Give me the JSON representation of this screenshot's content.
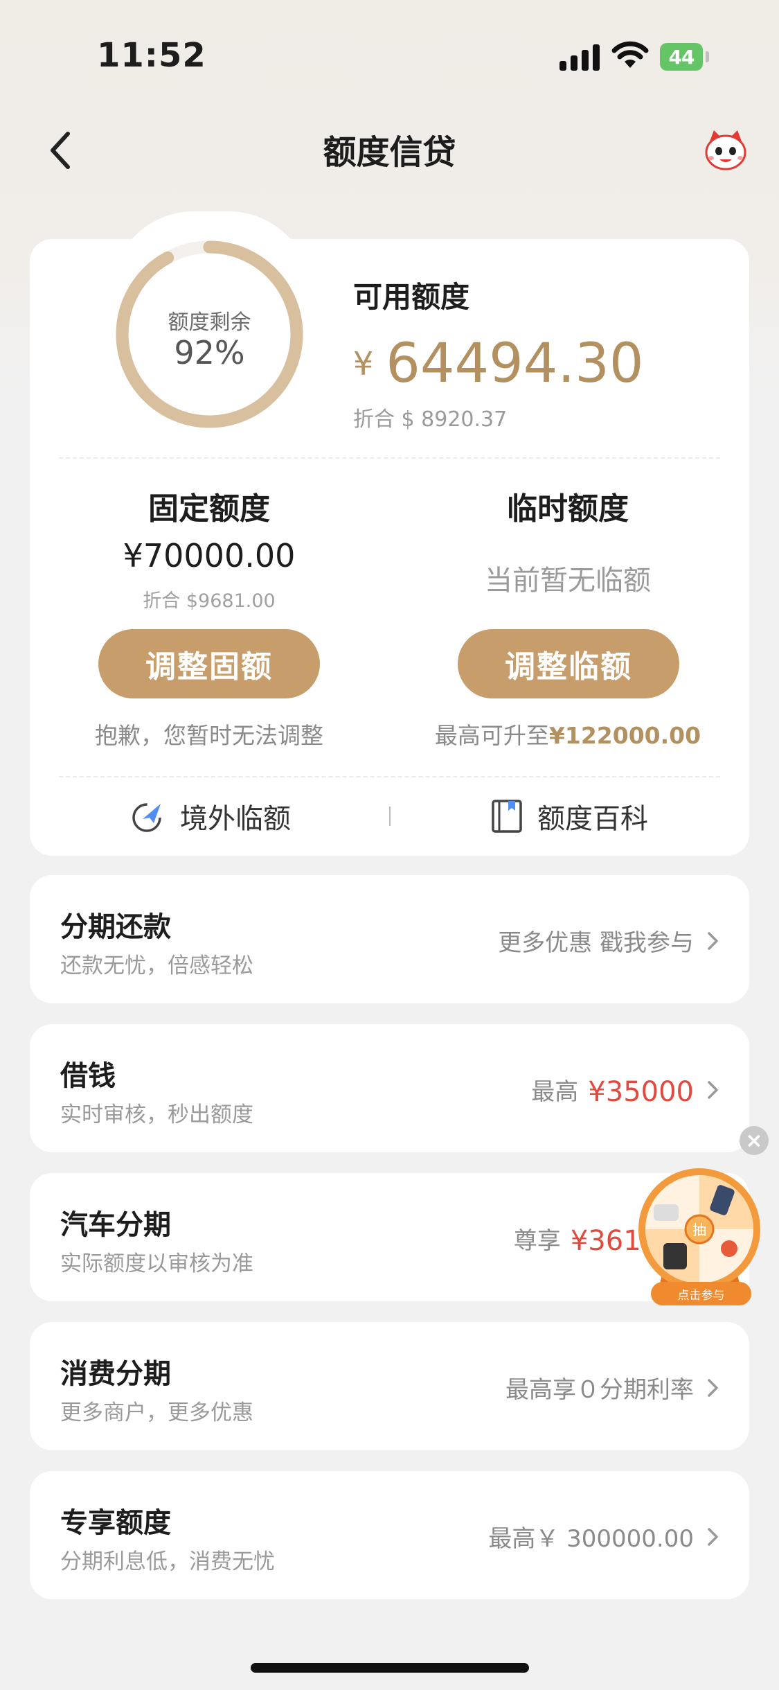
{
  "status_bar": {
    "time": "11:52",
    "battery": "44"
  },
  "nav": {
    "title": "额度信贷"
  },
  "summary": {
    "ring_label": "额度剩余",
    "ring_value": "92%",
    "ring_fraction": 0.92,
    "available_label": "可用额度",
    "available_currency": "¥",
    "available_amount": "64494.30",
    "available_usd": "折合 $ 8920.37"
  },
  "fixed": {
    "title": "固定额度",
    "amount": "¥70000.00",
    "usd": "折合 $9681.00",
    "button": "调整固额",
    "note": "抱歉，您暂时无法调整"
  },
  "temp": {
    "title": "临时额度",
    "status": "当前暂无临额",
    "button": "调整临额",
    "note_prefix": "最高可升至",
    "note_amount": "¥122000.00"
  },
  "links": {
    "overseas": "境外临额",
    "wiki": "额度百科"
  },
  "rows": [
    {
      "title": "分期还款",
      "sub": "还款无忧，倍感轻松",
      "right": "更多优惠 戳我参与",
      "highlight": ""
    },
    {
      "title": "借钱",
      "sub": "实时审核，秒出额度",
      "right": "最高",
      "highlight": "¥35000"
    },
    {
      "title": "汽车分期",
      "sub": "实际额度以审核为准",
      "right": "尊享",
      "highlight": "¥361000"
    },
    {
      "title": "消费分期",
      "sub": "更多商户，更多优惠",
      "right": "最高享０分期利率",
      "highlight": ""
    },
    {
      "title": "专享额度",
      "sub": "分期利息低，消费无忧",
      "right": "最高￥ 300000.00",
      "highlight": ""
    }
  ],
  "floating": {
    "center": "抽",
    "button": "点击参与"
  },
  "colors": {
    "gold": "#c69d6b",
    "gold_text": "#b3905f",
    "red": "#e04a3f"
  }
}
